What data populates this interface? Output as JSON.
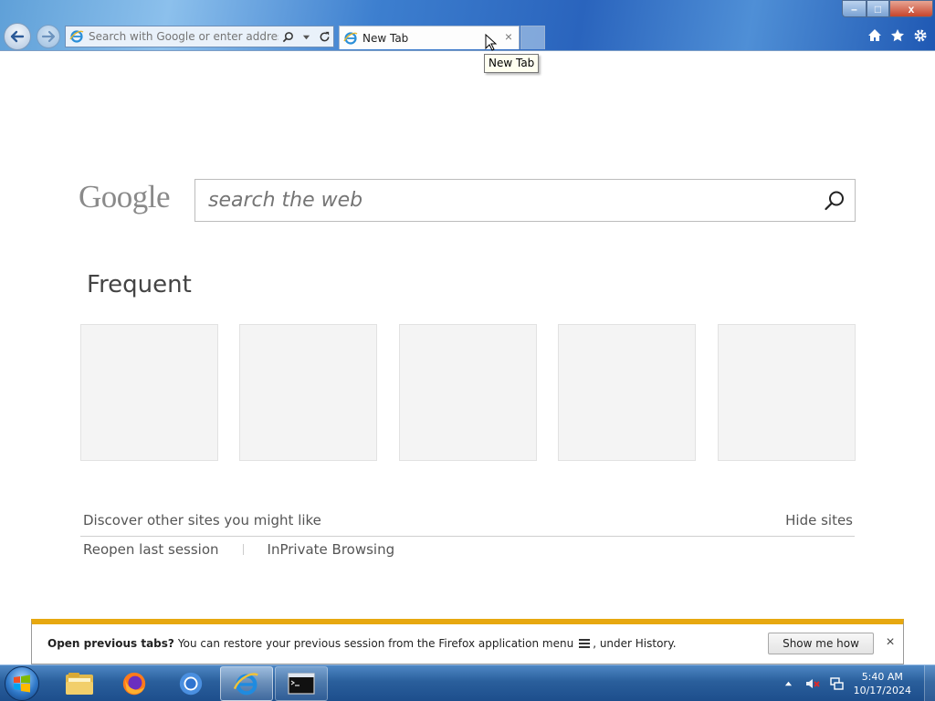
{
  "address_bar": {
    "placeholder": "Search with Google or enter address"
  },
  "tab": {
    "title": "New Tab",
    "close_glyph": "×"
  },
  "tooltip": "New Tab",
  "window_controls": {
    "minimize": "–",
    "maximize": "□",
    "close": "x"
  },
  "search": {
    "logo": "Google",
    "placeholder": "search the web"
  },
  "frequent": {
    "title": "Frequent",
    "tiles": [
      "",
      "",
      "",
      "",
      ""
    ]
  },
  "discover": {
    "label": "Discover other sites you might like",
    "hide_label": "Hide sites"
  },
  "links": {
    "reopen": "Reopen last session",
    "inprivate": "InPrivate Browsing"
  },
  "notification": {
    "bold": "Open previous tabs?",
    "text_before": "You can restore your previous session from the Firefox application menu",
    "text_after": ", under History.",
    "button": "Show me how",
    "close_glyph": "×"
  },
  "taskbar": {
    "apps": [
      "file-explorer-icon",
      "firefox-icon",
      "chrome-icon",
      "internet-explorer-icon",
      "command-prompt-icon"
    ],
    "active_app": "internet-explorer-icon"
  },
  "clock": {
    "time": "5:40 AM",
    "date": "10/17/2024"
  },
  "colors": {
    "notification_accent": "#e7a810",
    "title_bar": "#2a64bd",
    "taskbar": "#2a5f9c"
  }
}
